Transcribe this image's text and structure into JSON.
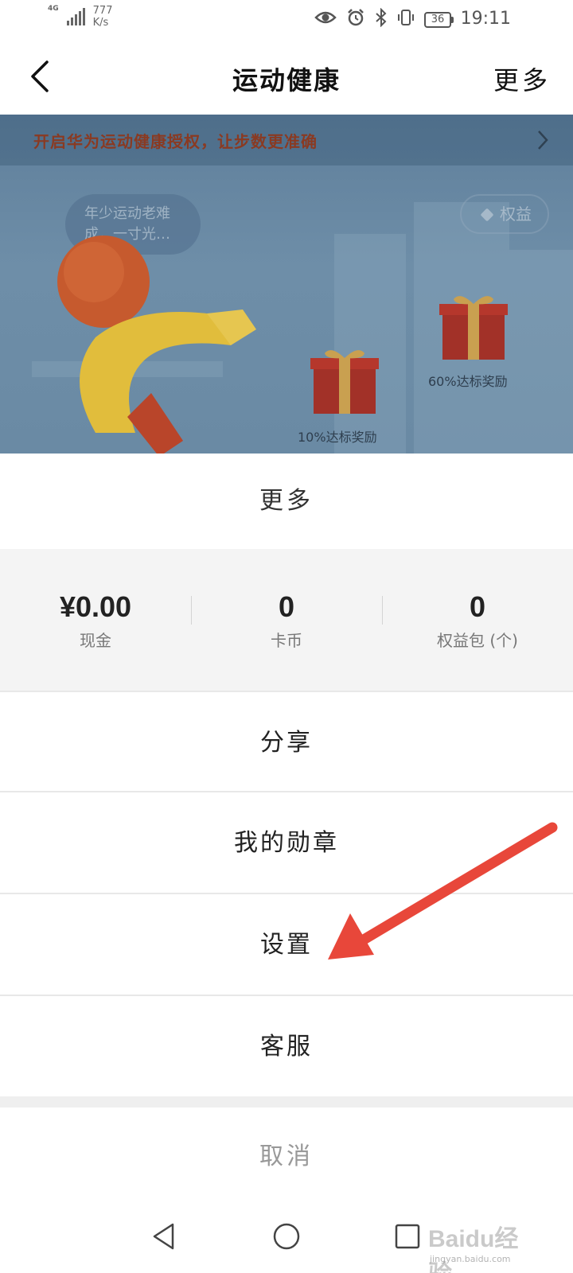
{
  "status_bar": {
    "network": "4G",
    "speed_value": "777",
    "speed_unit": "K/s",
    "battery": "36",
    "time": "19:11"
  },
  "header": {
    "title": "运动健康",
    "more_label": "更多"
  },
  "background": {
    "auth_banner": "开启华为运动健康授权，让步数更准确",
    "bubble_text": "年少运动老难成，一寸光…",
    "rights_label": "权益",
    "gift_labels": [
      "10%达标奖励",
      "60%达标奖励"
    ]
  },
  "sheet": {
    "title": "更多",
    "stats": [
      {
        "value": "¥0.00",
        "label": "现金"
      },
      {
        "value": "0",
        "label": "卡币"
      },
      {
        "value": "0",
        "label": "权益包 (个)"
      }
    ],
    "menu": [
      {
        "label": "分享"
      },
      {
        "label": "我的勋章"
      },
      {
        "label": "设置"
      },
      {
        "label": "客服"
      }
    ],
    "cancel_label": "取消"
  },
  "watermark": {
    "brand": "Baidu经验",
    "domain": "jingyan.baidu.com"
  },
  "colors": {
    "annotation_arrow": "#e8473a",
    "banner_text": "#8a3a22",
    "stats_background": "#f4f4f4"
  }
}
